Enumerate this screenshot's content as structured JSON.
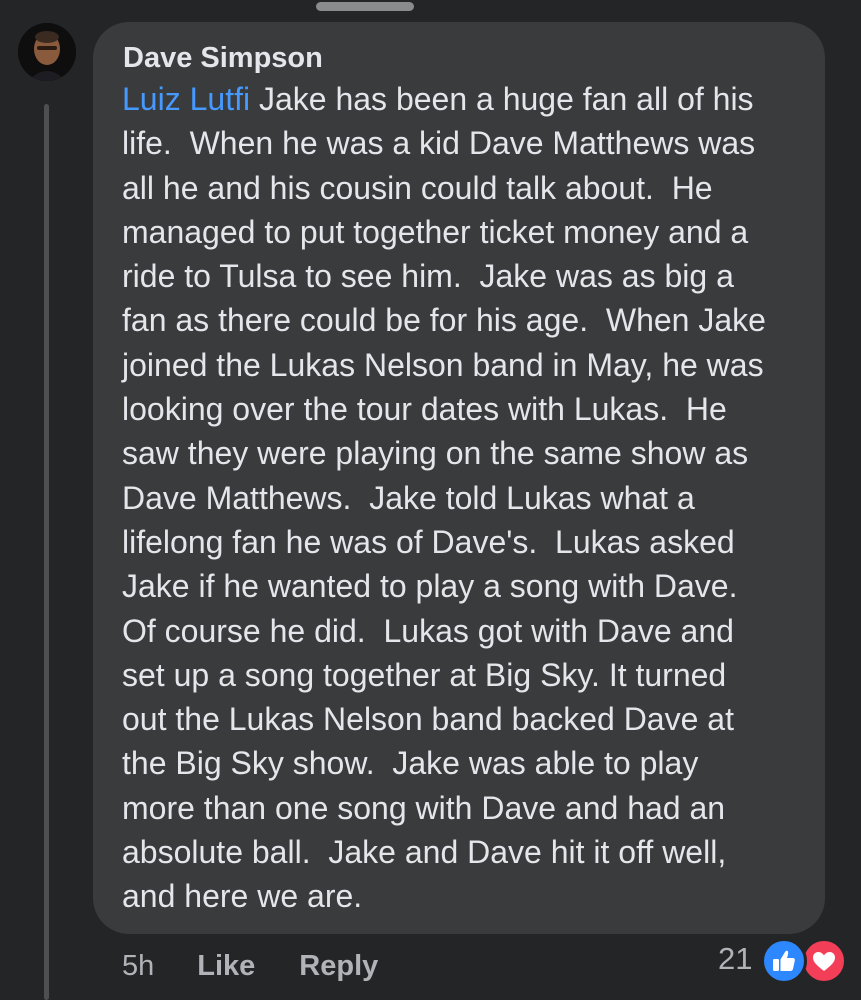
{
  "comment": {
    "author": "Dave Simpson",
    "mention": "Luiz Lutfi",
    "lines": [
      " Jake has been a huge fan all of his",
      "life.  When he was a kid Dave Matthews was",
      "all he and his cousin could talk about.  He",
      "managed to put together ticket money and a",
      "ride to Tulsa to see him.  Jake was as big a",
      "fan as there could be for his age.  When Jake",
      "joined the Lukas Nelson band in May, he was",
      "looking over the tour dates with Lukas.  He",
      "saw they were playing on the same show as",
      "Dave Matthews.  Jake told Lukas what a",
      "lifelong fan he was of Dave's.  Lukas asked",
      "Jake if he wanted to play a song with Dave.",
      "Of course he did.  Lukas got with Dave and",
      "set up a song together at Big Sky. It turned",
      "out the Lukas Nelson band backed Dave at",
      "the Big Sky show.  Jake was able to play",
      "more than one song with Dave and had an",
      "absolute ball.  Jake and Dave hit it off well,",
      "and here we are."
    ]
  },
  "actions": {
    "time": "5h",
    "like_label": "Like",
    "reply_label": "Reply"
  },
  "reactions": {
    "count": "21",
    "icons": [
      "like-reaction-icon",
      "love-reaction-icon"
    ]
  },
  "colors": {
    "background": "#242526",
    "bubble": "#3a3b3c",
    "text": "#e4e6eb",
    "secondary_text": "#b0b3b8",
    "mention": "#4599ff",
    "like": "#2d88ff",
    "love": "#f33e58"
  }
}
